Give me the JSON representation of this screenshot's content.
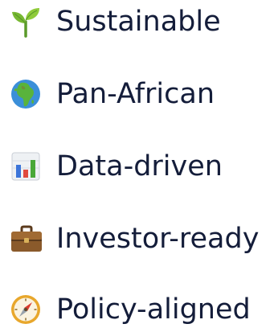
{
  "items": [
    {
      "icon": "seedling-icon",
      "label": "Sustainable"
    },
    {
      "icon": "globe-africa-icon",
      "label": "Pan-African"
    },
    {
      "icon": "bar-chart-icon",
      "label": "Data-driven"
    },
    {
      "icon": "briefcase-icon",
      "label": "Investor-ready"
    },
    {
      "icon": "compass-icon",
      "label": "Policy-aligned"
    }
  ],
  "colors": {
    "text": "#141d3a",
    "background": "#ffffff"
  }
}
